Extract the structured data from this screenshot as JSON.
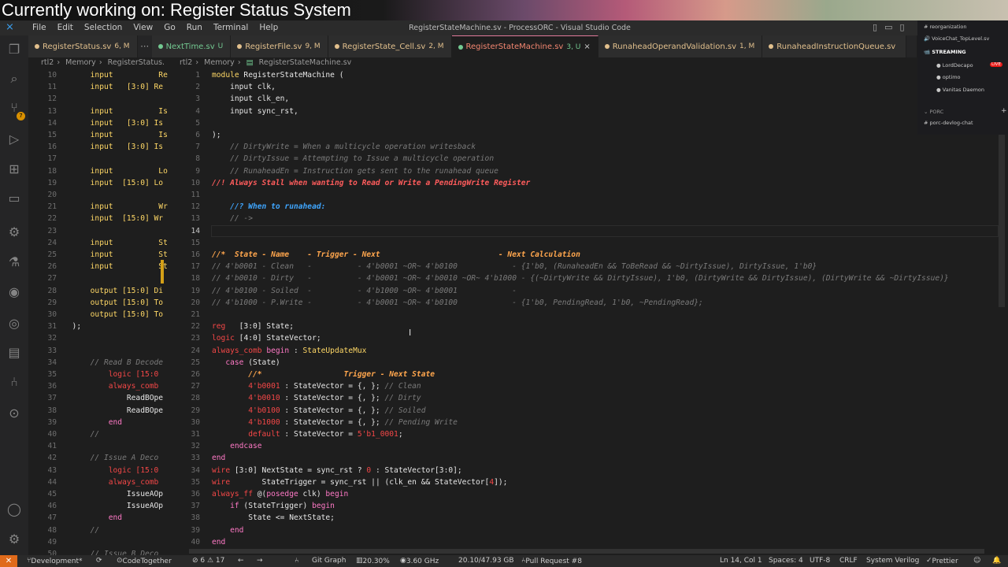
{
  "overlay": {
    "title": "Currently working on: Register Status System"
  },
  "titlebar": {
    "menu": [
      "File",
      "Edit",
      "Selection",
      "View",
      "Go",
      "Run",
      "Terminal",
      "Help"
    ],
    "window_title": "RegisterStateMachine.sv - ProcessORC - Visual Studio Code"
  },
  "tabs": [
    {
      "name": "RegisterStatus.sv",
      "mod": "6, M",
      "color": "#e2c08d"
    },
    {
      "name": "NextTime.sv",
      "mod": "U",
      "color": "#73c991"
    },
    {
      "name": "RegisterFile.sv",
      "mod": "9, M",
      "color": "#e2c08d"
    },
    {
      "name": "RegisterState_Cell.sv",
      "mod": "2, M",
      "color": "#e2c08d"
    },
    {
      "name": "RegisterStateMachine.sv",
      "mod": "3, U",
      "color": "#73c991"
    },
    {
      "name": "RunaheadOperandValidation.sv",
      "mod": "1, M",
      "color": "#e2c08d"
    },
    {
      "name": "RunaheadInstructionQueue.sv",
      "mod": "",
      "color": "#e2c08d"
    }
  ],
  "breadcrumbs": {
    "left": [
      "rtl2",
      "Memory",
      "RegisterStatus."
    ],
    "right": [
      "rtl2",
      "Memory",
      "RegisterStateMachine.sv"
    ]
  },
  "left_editor": {
    "lines": [
      {
        "n": "10",
        "t": "      input          Re"
      },
      {
        "n": "11",
        "t": "      input   [3:0] Re"
      },
      {
        "n": "12",
        "t": ""
      },
      {
        "n": "13",
        "t": "      input          Is"
      },
      {
        "n": "14",
        "t": "      input   [3:0] Is"
      },
      {
        "n": "15",
        "t": "      input          Is"
      },
      {
        "n": "16",
        "t": "      input   [3:0] Is"
      },
      {
        "n": "17",
        "t": ""
      },
      {
        "n": "18",
        "t": "      input          Lo"
      },
      {
        "n": "19",
        "t": "      input  [15:0] Lo"
      },
      {
        "n": "20",
        "t": ""
      },
      {
        "n": "21",
        "t": "      input          Wr"
      },
      {
        "n": "22",
        "t": "      input  [15:0] Wr"
      },
      {
        "n": "23",
        "t": ""
      },
      {
        "n": "24",
        "t": "      input          St"
      },
      {
        "n": "25",
        "t": "      input          St"
      },
      {
        "n": "26",
        "t": "      input          St"
      },
      {
        "n": "27",
        "t": ""
      },
      {
        "n": "28",
        "t": "      output [15:0] Di"
      },
      {
        "n": "29",
        "t": "      output [15:0] To"
      },
      {
        "n": "30",
        "t": "      output [15:0] To"
      },
      {
        "n": "31",
        "t": "  );"
      },
      {
        "n": "32",
        "t": ""
      },
      {
        "n": "33",
        "t": ""
      },
      {
        "n": "34",
        "t": "      // Read B Decode"
      },
      {
        "n": "35",
        "t": "          logic [15:0"
      },
      {
        "n": "36",
        "t": "          always_comb"
      },
      {
        "n": "37",
        "t": "              ReadBOpe"
      },
      {
        "n": "38",
        "t": "              ReadBOpe"
      },
      {
        "n": "39",
        "t": "          end"
      },
      {
        "n": "40",
        "t": "      //"
      },
      {
        "n": "41",
        "t": ""
      },
      {
        "n": "42",
        "t": "      // Issue A Deco"
      },
      {
        "n": "43",
        "t": "          logic [15:0"
      },
      {
        "n": "44",
        "t": "          always_comb"
      },
      {
        "n": "45",
        "t": "              IssueAOp"
      },
      {
        "n": "46",
        "t": "              IssueAOp"
      },
      {
        "n": "47",
        "t": "          end"
      },
      {
        "n": "48",
        "t": "      //"
      },
      {
        "n": "49",
        "t": ""
      },
      {
        "n": "50",
        "t": "      // Issue B Deco"
      }
    ]
  },
  "main_editor": {
    "cursor_line": "14",
    "lines": [
      {
        "n": "1",
        "segs": [
          [
            "kw2",
            "module"
          ],
          [
            "id",
            " RegisterStateMachine ("
          ]
        ]
      },
      {
        "n": "2",
        "segs": [
          [
            "id",
            "    input clk,"
          ]
        ]
      },
      {
        "n": "3",
        "segs": [
          [
            "id",
            "    input clk_en,"
          ]
        ]
      },
      {
        "n": "4",
        "segs": [
          [
            "id",
            "    input sync_rst,"
          ]
        ]
      },
      {
        "n": "5",
        "segs": []
      },
      {
        "n": "6",
        "segs": [
          [
            "id",
            ");"
          ]
        ]
      },
      {
        "n": "7",
        "segs": [
          [
            "cm",
            "    // DirtyWrite = When a multicycle operation writesback"
          ]
        ]
      },
      {
        "n": "8",
        "segs": [
          [
            "cm",
            "    // DirtyIssue = Attempting to Issue a multicycle operation"
          ]
        ]
      },
      {
        "n": "9",
        "segs": [
          [
            "cm",
            "    // RunaheadEn = Instruction gets sent to the runahead queue"
          ]
        ]
      },
      {
        "n": "10",
        "segs": [
          [
            "rc",
            "//! Always Stall when wanting to Read or Write a PendingWrite Register"
          ]
        ]
      },
      {
        "n": "11",
        "segs": []
      },
      {
        "n": "12",
        "segs": [
          [
            "bq",
            "    //? When to runahead:"
          ]
        ]
      },
      {
        "n": "13",
        "segs": [
          [
            "cm",
            "    // ->"
          ]
        ]
      },
      {
        "n": "14",
        "segs": []
      },
      {
        "n": "15",
        "segs": []
      },
      {
        "n": "16",
        "segs": [
          [
            "hd",
            "//*  State - Name    - Trigger - Next                          - Next Calculation"
          ]
        ]
      },
      {
        "n": "17",
        "segs": [
          [
            "cm",
            "// 4'b0001 - Clean   -          - 4'b0001 ~OR~ 4'b0100            - {1'b0, (RunaheadEn && ToBeRead && ~DirtyIssue), DirtyIssue, 1'b0}"
          ]
        ]
      },
      {
        "n": "18",
        "segs": [
          [
            "cm",
            "// 4'b0010 - Dirty   -          - 4'b0001 ~OR~ 4'b0010 ~OR~ 4'b1000 - {(~DirtyWrite && DirtyIssue), 1'b0, (DirtyWrite && DirtyIssue), (DirtyWrite && ~DirtyIssue)}"
          ]
        ]
      },
      {
        "n": "19",
        "segs": [
          [
            "cm",
            "// 4'b0100 - Soiled  -          - 4'b1000 ~OR~ 4'b0001            -"
          ]
        ]
      },
      {
        "n": "20",
        "segs": [
          [
            "cm",
            "// 4'b1000 - P.Write -          - 4'b0001 ~OR~ 4'b0100            - {1'b0, PendingRead, 1'b0, ~PendingRead};"
          ]
        ]
      },
      {
        "n": "21",
        "segs": []
      },
      {
        "n": "22",
        "segs": [
          [
            "kw",
            "reg"
          ],
          [
            "id",
            "   [3:0] State;"
          ]
        ]
      },
      {
        "n": "23",
        "segs": [
          [
            "kw",
            "logic"
          ],
          [
            "id",
            " [4:0] StateVector;"
          ]
        ]
      },
      {
        "n": "24",
        "segs": [
          [
            "kw",
            "always_comb"
          ],
          [
            "pur",
            " begin"
          ],
          [
            "id",
            " : "
          ],
          [
            "kw2",
            "StateUpdateMux"
          ]
        ]
      },
      {
        "n": "25",
        "segs": [
          [
            "pur",
            "   case"
          ],
          [
            "id",
            " (State)"
          ]
        ]
      },
      {
        "n": "26",
        "segs": [
          [
            "hd",
            "        //*                  Trigger - Next State"
          ]
        ]
      },
      {
        "n": "27",
        "segs": [
          [
            "kw",
            "        4'b0001"
          ],
          [
            "id",
            " : StateVector = {, }; "
          ],
          [
            "cm",
            "// Clean"
          ]
        ]
      },
      {
        "n": "28",
        "segs": [
          [
            "kw",
            "        4'b0010"
          ],
          [
            "id",
            " : StateVector = {, }; "
          ],
          [
            "cm",
            "// Dirty"
          ]
        ]
      },
      {
        "n": "29",
        "segs": [
          [
            "kw",
            "        4'b0100"
          ],
          [
            "id",
            " : StateVector = {, }; "
          ],
          [
            "cm",
            "// Soiled"
          ]
        ]
      },
      {
        "n": "30",
        "segs": [
          [
            "kw",
            "        4'b1000"
          ],
          [
            "id",
            " : StateVector = {, }; "
          ],
          [
            "cm",
            "// Pending Write"
          ]
        ]
      },
      {
        "n": "31",
        "segs": [
          [
            "kw",
            "        default"
          ],
          [
            "id",
            " : StateVector = "
          ],
          [
            "kw",
            "5'b1_0001"
          ],
          [
            "id",
            ";"
          ]
        ]
      },
      {
        "n": "32",
        "segs": [
          [
            "pur",
            "    endcase"
          ]
        ]
      },
      {
        "n": "33",
        "segs": [
          [
            "pur",
            "end"
          ]
        ]
      },
      {
        "n": "34",
        "segs": [
          [
            "kw",
            "wire"
          ],
          [
            "id",
            " [3:0] NextState = sync_rst ? "
          ],
          [
            "kw",
            "0"
          ],
          [
            "id",
            " : StateVector[3:0];"
          ]
        ]
      },
      {
        "n": "35",
        "segs": [
          [
            "kw",
            "wire"
          ],
          [
            "id",
            "       StateTrigger = sync_rst || (clk_en && StateVector["
          ],
          [
            "kw",
            "4"
          ],
          [
            "id",
            "]);"
          ]
        ]
      },
      {
        "n": "36",
        "segs": [
          [
            "kw",
            "always_ff"
          ],
          [
            "id",
            " @("
          ],
          [
            "pur",
            "posedge"
          ],
          [
            "id",
            " clk) "
          ],
          [
            "pur",
            "begin"
          ]
        ]
      },
      {
        "n": "37",
        "segs": [
          [
            "pur",
            "    if"
          ],
          [
            "id",
            " (StateTrigger) "
          ],
          [
            "pur",
            "begin"
          ]
        ]
      },
      {
        "n": "38",
        "segs": [
          [
            "id",
            "        State <= NextState;"
          ]
        ]
      },
      {
        "n": "39",
        "segs": [
          [
            "pur",
            "    end"
          ]
        ]
      },
      {
        "n": "40",
        "segs": [
          [
            "pur",
            "end"
          ]
        ]
      }
    ]
  },
  "chat": {
    "channel": "reorganization",
    "voice": "VoiceChat_TopLevel.sv",
    "section": "STREAMING",
    "users": [
      "LordDecapo",
      "optimo",
      "Vanitas Daemon"
    ],
    "live": "LIVE",
    "group": "PORC",
    "channel2": "porc-devlog-chat"
  },
  "statusbar": {
    "remote": "✕",
    "branch": "Development*",
    "sync": "⟳",
    "codetogether": "CodeTogether",
    "problems": "⊘ 6 ⚠ 17",
    "gitgraph": "Git Graph",
    "cpu": "20.30%",
    "ghz": "3.60 GHz",
    "mem": "20.10/47.93 GB",
    "pr": "Pull Request #8",
    "pos": "Ln 14, Col 1",
    "spaces": "Spaces: 4",
    "enc": "UTF-8",
    "eol": "CRLF",
    "lang": "System Verilog",
    "prettier": "Prettier"
  }
}
